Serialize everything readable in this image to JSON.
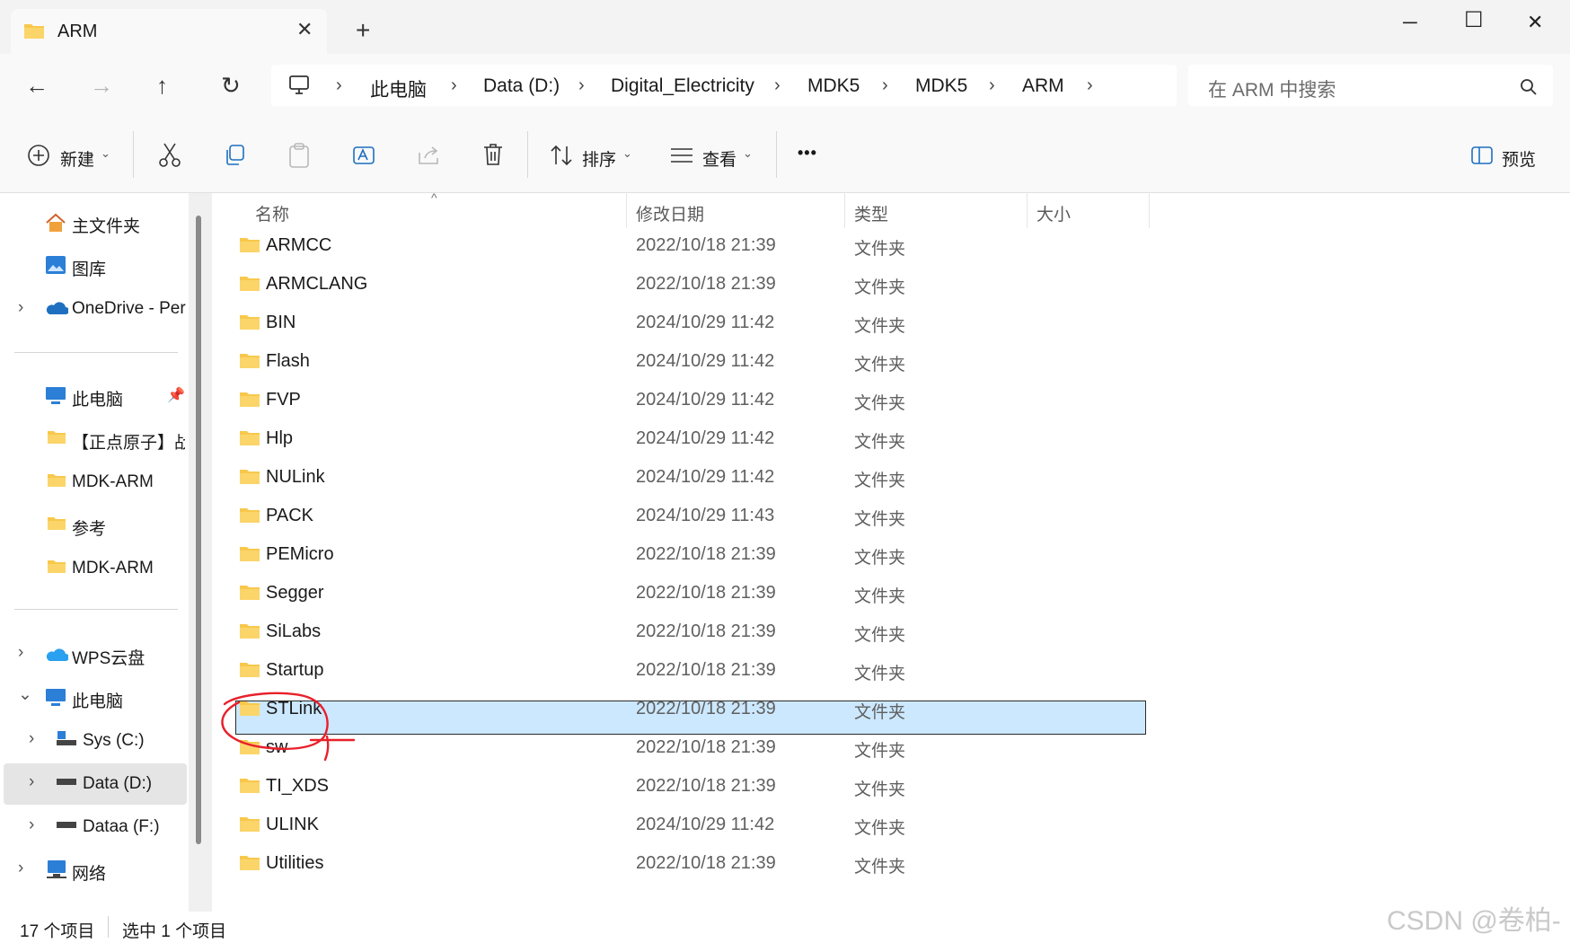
{
  "window": {
    "tab_title": "ARM",
    "new_tab": "+",
    "close_tab": "✕",
    "minimize": "─",
    "maximize": "☐",
    "close": "✕"
  },
  "nav": {
    "back": "←",
    "forward": "→",
    "up": "↑",
    "refresh": "↻",
    "breadcrumb": [
      "此电脑",
      "Data (D:)",
      "Digital_Electricity",
      "MDK5",
      "MDK5",
      "ARM"
    ],
    "separator": "›",
    "search_placeholder": "在 ARM 中搜索"
  },
  "toolbar": {
    "new_label": "新建",
    "sort_label": "排序",
    "view_label": "查看",
    "more": "•••",
    "preview_label": "预览"
  },
  "sidebar": {
    "quick": [
      {
        "label": "主文件夹",
        "icon": "home-icon"
      },
      {
        "label": "图库",
        "icon": "gallery-icon"
      },
      {
        "label": "OneDrive - Per",
        "icon": "onedrive-icon"
      }
    ],
    "pinned": [
      {
        "label": "此电脑",
        "icon": "pc-icon"
      },
      {
        "label": "【正点原子】战",
        "icon": "folder-icon"
      },
      {
        "label": "MDK-ARM",
        "icon": "folder-icon"
      },
      {
        "label": "参考",
        "icon": "folder-icon"
      },
      {
        "label": "MDK-ARM",
        "icon": "folder-icon"
      }
    ],
    "tree": [
      {
        "label": "WPS云盘",
        "icon": "cloud-icon"
      },
      {
        "label": "此电脑",
        "icon": "pc-icon"
      },
      {
        "label": "Sys (C:)",
        "icon": "drive-icon"
      },
      {
        "label": "Data (D:)",
        "icon": "drive-icon"
      },
      {
        "label": "Dataa (F:)",
        "icon": "drive-icon"
      },
      {
        "label": "网络",
        "icon": "network-icon"
      }
    ]
  },
  "columns": {
    "name": "名称",
    "date": "修改日期",
    "type": "类型",
    "size": "大小"
  },
  "files": [
    {
      "name": "ARMCC",
      "date": "2022/10/18 21:39",
      "type": "文件夹"
    },
    {
      "name": "ARMCLANG",
      "date": "2022/10/18 21:39",
      "type": "文件夹"
    },
    {
      "name": "BIN",
      "date": "2024/10/29 11:42",
      "type": "文件夹"
    },
    {
      "name": "Flash",
      "date": "2024/10/29 11:42",
      "type": "文件夹"
    },
    {
      "name": "FVP",
      "date": "2024/10/29 11:42",
      "type": "文件夹"
    },
    {
      "name": "Hlp",
      "date": "2024/10/29 11:42",
      "type": "文件夹"
    },
    {
      "name": "NULink",
      "date": "2024/10/29 11:42",
      "type": "文件夹"
    },
    {
      "name": "PACK",
      "date": "2024/10/29 11:43",
      "type": "文件夹"
    },
    {
      "name": "PEMicro",
      "date": "2022/10/18 21:39",
      "type": "文件夹"
    },
    {
      "name": "Segger",
      "date": "2022/10/18 21:39",
      "type": "文件夹"
    },
    {
      "name": "SiLabs",
      "date": "2022/10/18 21:39",
      "type": "文件夹"
    },
    {
      "name": "Startup",
      "date": "2022/10/18 21:39",
      "type": "文件夹"
    },
    {
      "name": "STLink",
      "date": "2022/10/18 21:39",
      "type": "文件夹"
    },
    {
      "name": "sw",
      "date": "2022/10/18 21:39",
      "type": "文件夹"
    },
    {
      "name": "TI_XDS",
      "date": "2022/10/18 21:39",
      "type": "文件夹"
    },
    {
      "name": "ULINK",
      "date": "2024/10/29 11:42",
      "type": "文件夹"
    },
    {
      "name": "Utilities",
      "date": "2022/10/18 21:39",
      "type": "文件夹"
    }
  ],
  "selected_file": "STLink",
  "status": {
    "count": "17 个项目",
    "selected": "选中 1 个项目"
  },
  "watermark": "CSDN @卷柏-",
  "colors": {
    "selection": "#cce8ff",
    "folder": "#f8c84c",
    "annotation": "#e8202a"
  }
}
